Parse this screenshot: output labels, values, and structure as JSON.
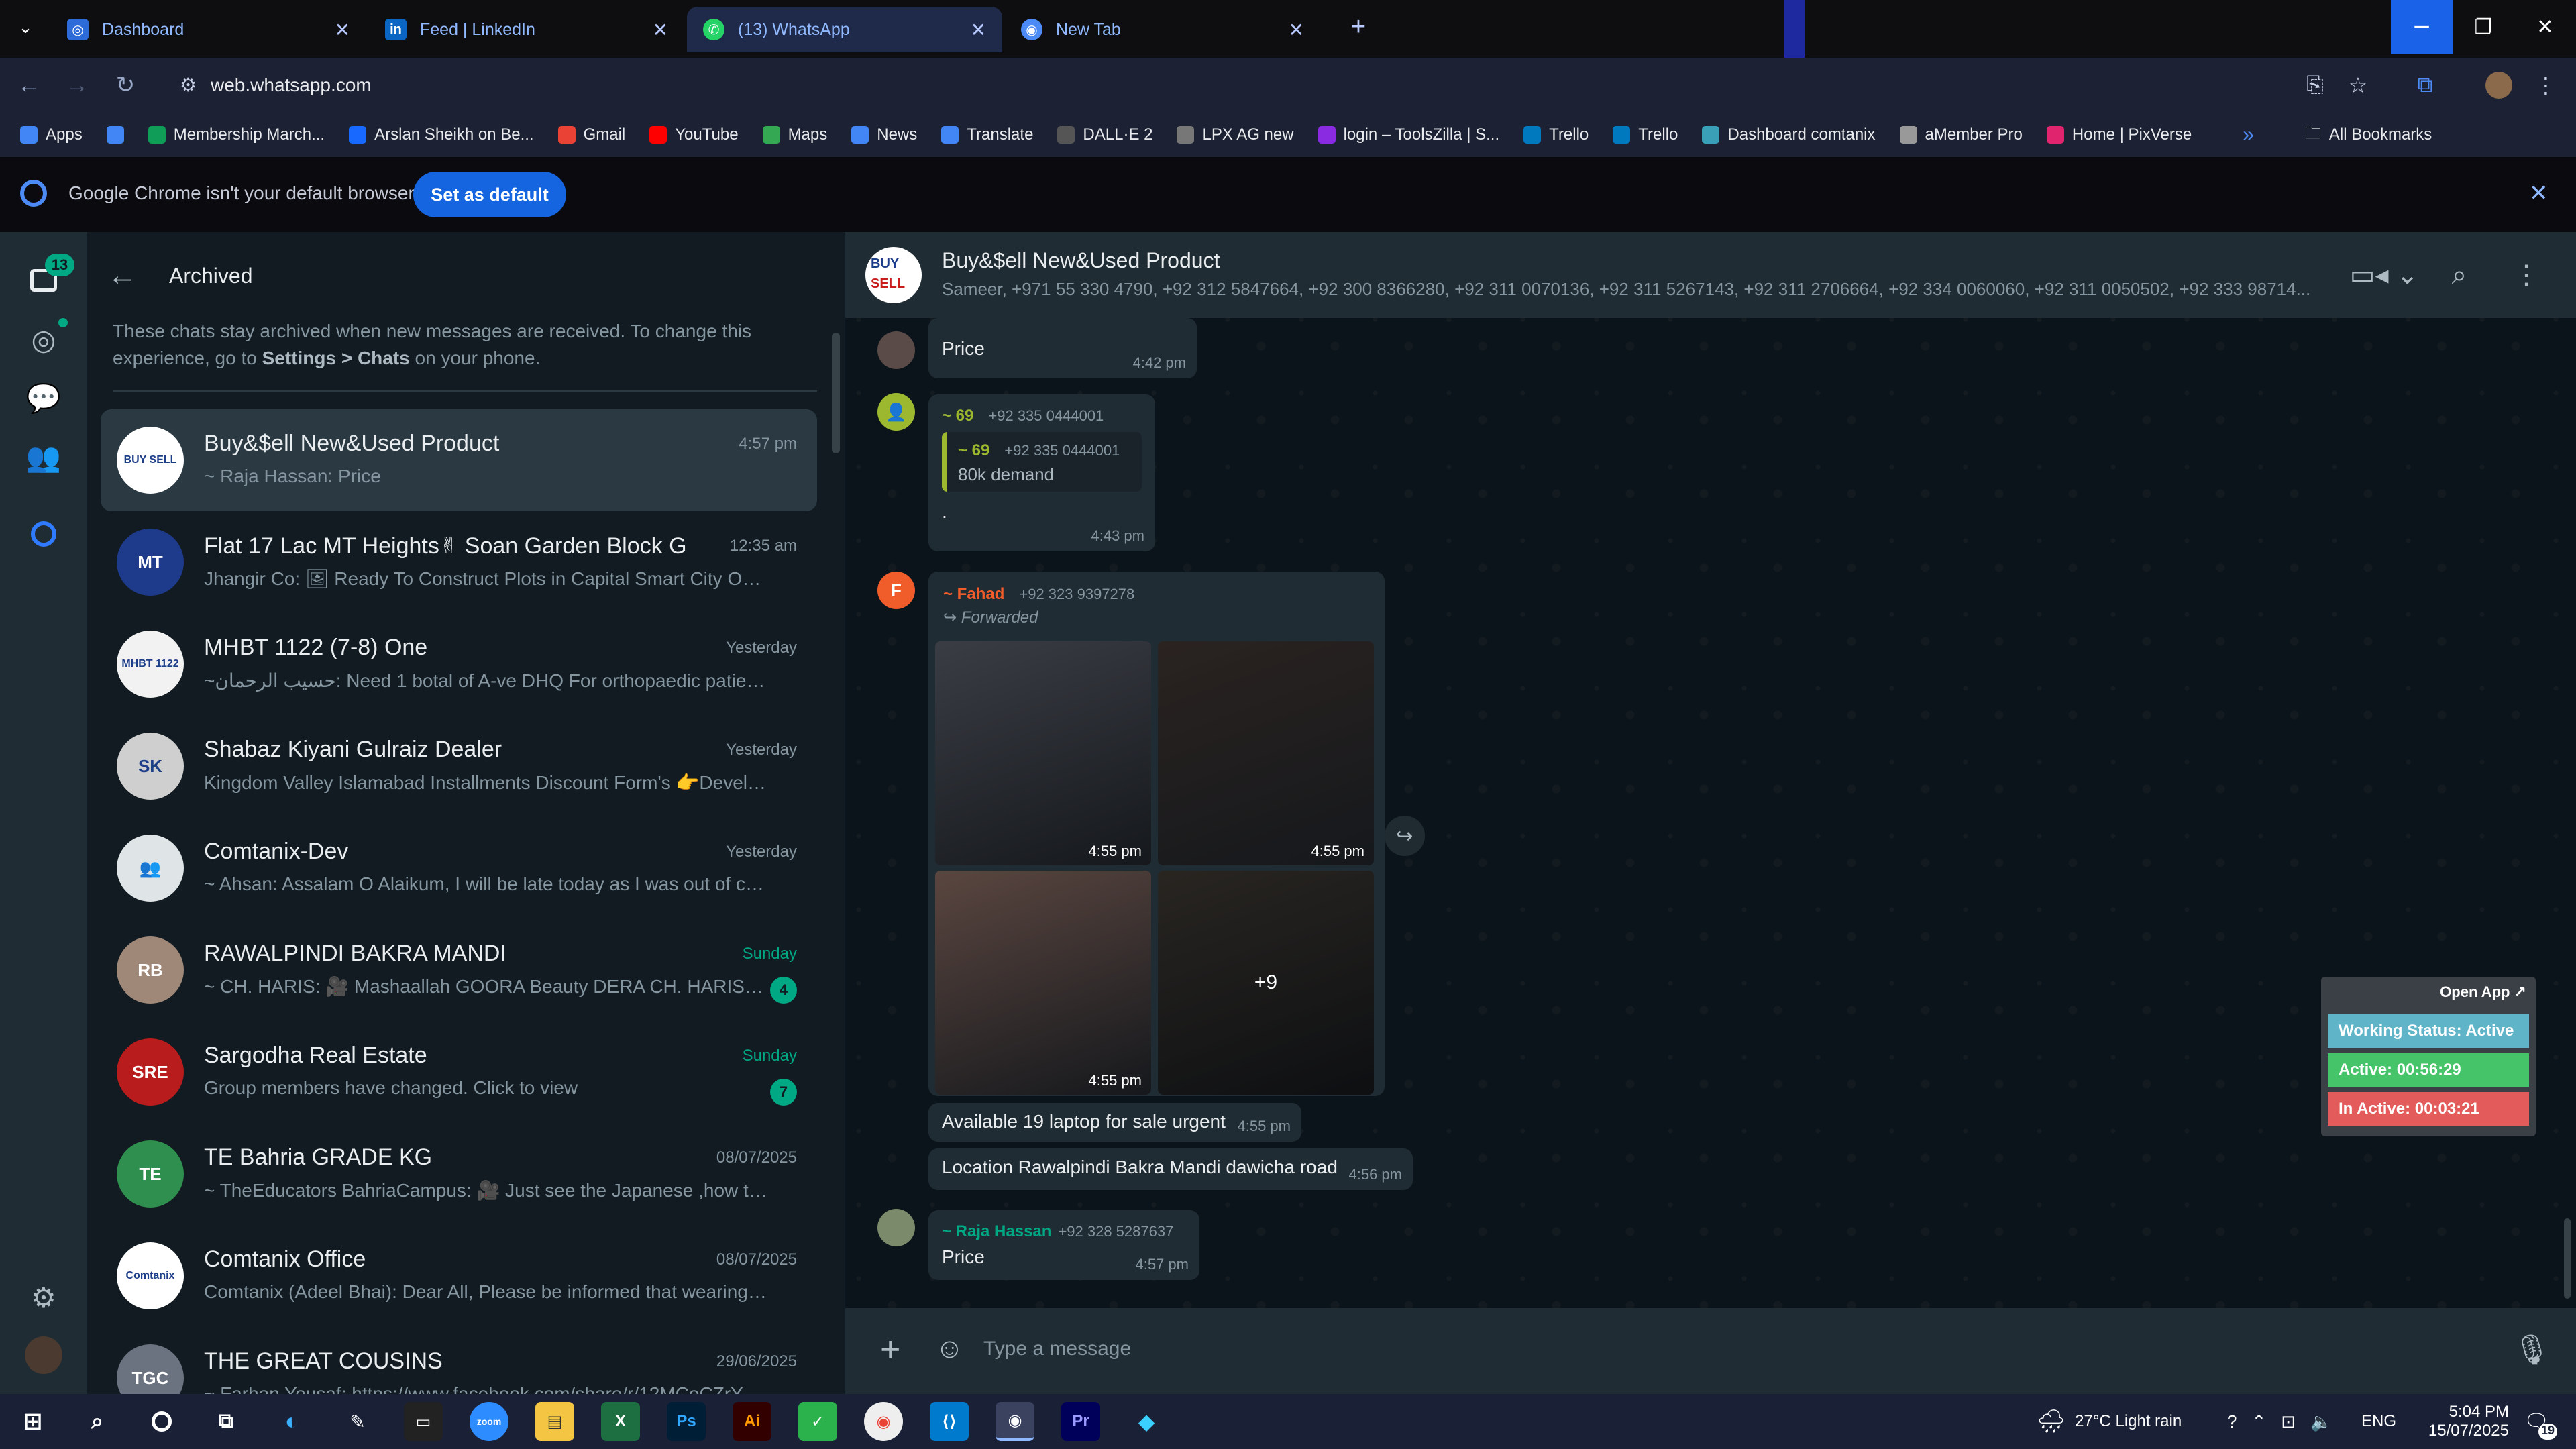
{
  "browser": {
    "tabs": [
      {
        "title": "Dashboard",
        "icon": "dashboard-favicon",
        "color": "#2d6bd8"
      },
      {
        "title": "Feed | LinkedIn",
        "icon": "linkedin-favicon",
        "color": "#0a66c2"
      },
      {
        "title": "(13) WhatsApp",
        "icon": "whatsapp-favicon",
        "color": "#25d366"
      },
      {
        "title": "New Tab",
        "icon": "chrome-favicon",
        "color": "#4c8bf5"
      }
    ],
    "url": "web.whatsapp.com",
    "bookmarks": [
      {
        "label": "Apps",
        "icon": "apps-grid-icon",
        "color": "#4285f4"
      },
      {
        "label": "",
        "icon": "grid-icon",
        "color": "#4285f4"
      },
      {
        "label": "Membership March...",
        "icon": "sheets-icon",
        "color": "#0f9d58"
      },
      {
        "label": "Arslan Sheikh on Be...",
        "icon": "behance-icon",
        "color": "#1769ff"
      },
      {
        "label": "Gmail",
        "icon": "gmail-icon",
        "color": "#ea4335"
      },
      {
        "label": "YouTube",
        "icon": "youtube-icon",
        "color": "#ff0000"
      },
      {
        "label": "Maps",
        "icon": "maps-icon",
        "color": "#34a853"
      },
      {
        "label": "News",
        "icon": "news-icon",
        "color": "#4285f4"
      },
      {
        "label": "Translate",
        "icon": "translate-icon",
        "color": "#4285f4"
      },
      {
        "label": "DALL·E 2",
        "icon": "openai-icon",
        "color": "#555555"
      },
      {
        "label": "LPX AG new",
        "icon": "dash-icon",
        "color": "#777777"
      },
      {
        "label": "login – ToolsZilla | S...",
        "icon": "toolszilla-icon",
        "color": "#8a2be2"
      },
      {
        "label": "Trello",
        "icon": "trello-icon",
        "color": "#0079bf"
      },
      {
        "label": "Trello",
        "icon": "trello-icon",
        "color": "#0079bf"
      },
      {
        "label": "Dashboard comtanix",
        "icon": "comtanix-icon",
        "color": "#3aa0b8"
      },
      {
        "label": "aMember Pro",
        "icon": "amember-icon",
        "color": "#999999"
      },
      {
        "label": "Home | PixVerse",
        "icon": "pixverse-icon",
        "color": "#e0246e"
      }
    ],
    "all_bookmarks": "All Bookmarks"
  },
  "infobar": {
    "message": "Google Chrome isn't your default browser",
    "button": "Set as default"
  },
  "rail": {
    "chats_badge": "13"
  },
  "archived": {
    "title": "Archived",
    "note_pre": "These chats stay archived when new messages are received. To change this experience, go to ",
    "note_bold1": "Settings > Chats",
    "note_post": " on your phone."
  },
  "chats": [
    {
      "name": "Buy&$ell New&Used Product",
      "time": "4:57 pm",
      "preview": "~ Raja Hassan: Price",
      "avatar_text": "BUY SELL",
      "avatar_color": "#ffffff",
      "unread": ""
    },
    {
      "name": "Flat 17 Lac MT Heights✌ Soan Garden Block G",
      "time": "12:35 am",
      "preview": "Jhangir Co: 🖼 Ready To Construct Plots in Capital Smart City  On Ins...",
      "avatar_text": "MT",
      "avatar_color": "#1e3a8a",
      "unread": ""
    },
    {
      "name": "MHBT 1122 (7-8) One",
      "time": "Yesterday",
      "preview": "~حسیب الرحمان: Need 1 botal of A-ve DHQ For orthopaedic patient ...",
      "avatar_text": "MHBT 1122",
      "avatar_color": "#f2f2f2",
      "unread": ""
    },
    {
      "name": "Shabaz Kiyani Gulraiz Dealer",
      "time": "Yesterday",
      "preview": "Kingdom Valley Islamabad Installments Discount Form's 👉Develop...",
      "avatar_text": "SK",
      "avatar_color": "#cfcfcf",
      "unread": ""
    },
    {
      "name": "Comtanix-Dev",
      "time": "Yesterday",
      "preview": "~ Ahsan: Assalam O Alaikum, I will be late today as I was out of city, j...",
      "avatar_text": "👥",
      "avatar_color": "#dfe5e7",
      "unread": ""
    },
    {
      "name": "RAWALPINDI BAKRA MANDI",
      "time": "Sunday",
      "preview": "~ CH. HARIS: 🎥 Mashaallah GOORA  Beauty DERA CH. HARIS. D...",
      "avatar_text": "RB",
      "avatar_color": "#a08878",
      "unread": "4"
    },
    {
      "name": "Sargodha Real Estate",
      "time": "Sunday",
      "preview": "Group members have changed. Click to view",
      "avatar_text": "SRE",
      "avatar_color": "#b91c1c",
      "unread": "7"
    },
    {
      "name": "TE Bahria GRADE KG",
      "time": "08/07/2025",
      "preview": "~ TheEducators BahriaCampus: 🎥 Just see  the Japanese ,how they ...",
      "avatar_text": "TE",
      "avatar_color": "#2f8f4e",
      "unread": ""
    },
    {
      "name": "Comtanix Office",
      "time": "08/07/2025",
      "preview": "Comtanix (Adeel Bhai): Dear All,  Please be informed that wearing yo...",
      "avatar_text": "Comtanix",
      "avatar_color": "#ffffff",
      "unread": ""
    },
    {
      "name": "THE GREAT COUSINS",
      "time": "29/06/2025",
      "preview": "~ Farhan Yousaf: https://www.facebook.com/share/r/12MCeCZrYbH/",
      "avatar_text": "TGC",
      "avatar_color": "#6b7280",
      "unread": ""
    }
  ],
  "conversation": {
    "name": "Buy&$ell New&Used Product",
    "members": "Sameer, +971 55 330 4790, +92 312 5847664, +92 300 8366280, +92 311 0070136, +92 311 5267143, +92 311 2706664, +92 334 0060060, +92 311 0050502, +92 333 98714...",
    "messages": {
      "m1": {
        "text": "Price",
        "time": "4:42 pm"
      },
      "m2": {
        "sender": "~ 69",
        "phone": "+92 335 0444001",
        "quote_sender": "~ 69",
        "quote_phone": "+92 335 0444001",
        "quote_text": "80k demand",
        "text": ".",
        "time": "4:43 pm",
        "avatar_color": "#9cb82f"
      },
      "m3": {
        "sender": "~ Fahad",
        "phone": "+92 323 9397278",
        "forwarded": "Forwarded",
        "avatar_letter": "F",
        "avatar_color": "#f15c2b",
        "photos": [
          {
            "time": "4:55 pm",
            "color": "#3a3d44",
            "label": ""
          },
          {
            "time": "4:55 pm",
            "color": "#2a2320",
            "label": ""
          },
          {
            "time": "4:55 pm",
            "color": "#5a4640",
            "label": ""
          },
          {
            "time": "",
            "color": "#3f3a34",
            "label": "+9"
          }
        ]
      },
      "m4": {
        "text": "Available 19 laptop for sale urgent",
        "time": "4:55 pm"
      },
      "m5": {
        "text": "Location Rawalpindi Bakra Mandi dawicha road",
        "time": "4:56 pm"
      },
      "m6": {
        "sender": "~ Raja Hassan",
        "phone": "+92 328 5287637",
        "text": "Price",
        "time": "4:57 pm"
      }
    },
    "composer_placeholder": "Type a message"
  },
  "tracker": {
    "open_app": "Open App ↗",
    "status": "Working Status: Active",
    "active": "Active: 00:56:29",
    "inactive": "In Active: 00:03:21",
    "status_color": "#5fb4c8",
    "active_color": "#45c46a",
    "inactive_color": "#e35b5b"
  },
  "taskbar": {
    "weather": "27°C  Light rain",
    "lang": "ENG",
    "time": "5:04 PM",
    "date": "15/07/2025",
    "notifications": "19"
  }
}
